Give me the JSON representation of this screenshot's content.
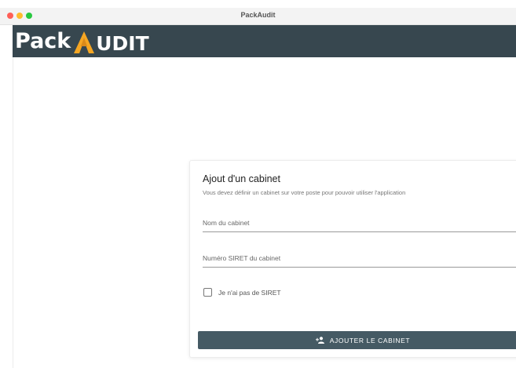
{
  "window": {
    "title": "PackAudit"
  },
  "logo": {
    "text_left": "Pack",
    "text_right": "UDIT",
    "accent_color": "#f5a623"
  },
  "colors": {
    "header_bg": "#37474f",
    "button_bg": "#455a64"
  },
  "card": {
    "title": "Ajout d'un cabinet",
    "subtitle": "Vous devez définir un cabinet sur votre poste pour pouvoir utiliser l'application",
    "name_field_label": "Nom du cabinet",
    "siret_field_label": "Numéro SIRET du cabinet",
    "no_siret_checkbox_label": "Je n'ai pas de SIRET",
    "no_siret_checked": false,
    "submit_label": "AJOUTER LE CABINET",
    "submit_icon": "add-user-icon"
  }
}
